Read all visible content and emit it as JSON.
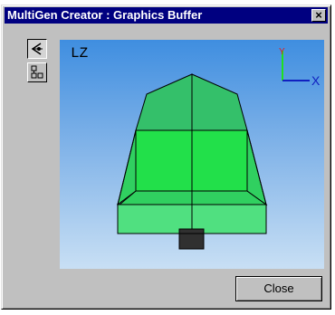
{
  "window": {
    "title": "MultiGen Creator : Graphics Buffer",
    "close_glyph": "×"
  },
  "toolbar": {
    "view_tool_icon": "eye-view-icon",
    "layout_tool_icon": "hierarchy-icon"
  },
  "viewport": {
    "label": "LZ",
    "axis_x_label": "X",
    "axis_y_label": "Y",
    "background_top": "#3f8ee0",
    "background_bottom": "#c8dff4",
    "model_color": "#3fe07a"
  },
  "buttons": {
    "close_label": "Close"
  }
}
